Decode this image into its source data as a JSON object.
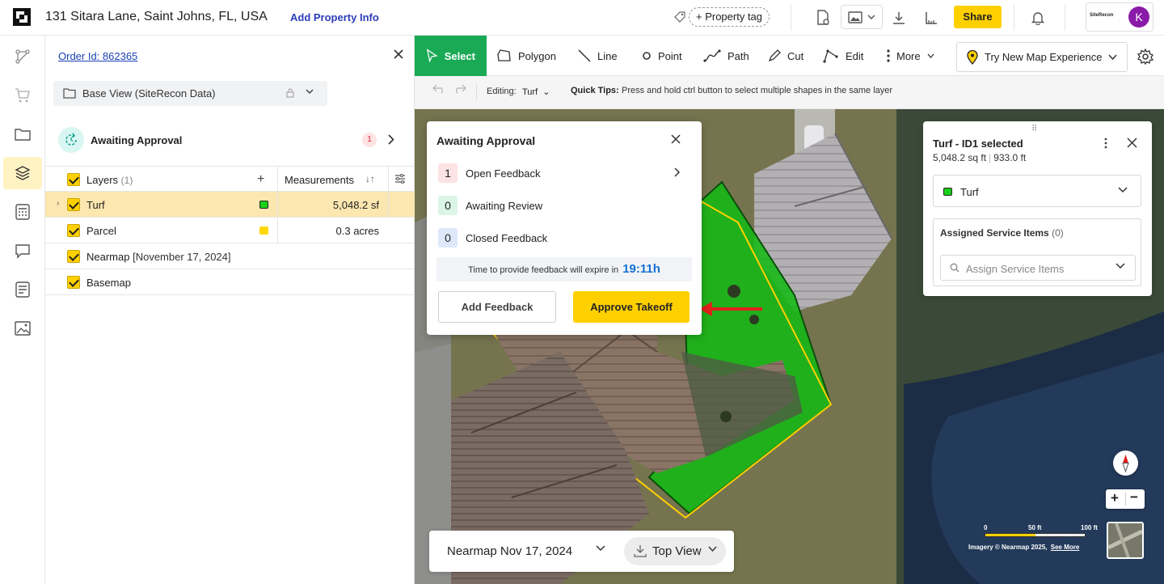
{
  "header": {
    "address": "131 Sitara Lane, Saint Johns, FL, USA",
    "add_property_info": "Add Property Info",
    "property_tag": "+ Property tag",
    "share_label": "Share",
    "account_brand": "SiteRecon",
    "avatar_initial": "K"
  },
  "panel": {
    "order_id": "Order Id: 862365",
    "base_view": "Base View (SiteRecon Data)",
    "approval": {
      "label": "Awaiting Approval",
      "count": "1"
    },
    "layers_header": {
      "label": "Layers",
      "count": "(1)",
      "measurements": "Measurements"
    },
    "layers": [
      {
        "name": "Turf",
        "extra": "",
        "measurement": "5,048.2 sf",
        "color": "#18d018"
      },
      {
        "name": "Parcel",
        "extra": "",
        "measurement": "0.3 acres",
        "color": "#ffd900"
      },
      {
        "name": "Nearmap",
        "extra": "[November 17, 2024]",
        "measurement": "",
        "color": ""
      },
      {
        "name": "Basemap",
        "extra": "",
        "measurement": "",
        "color": ""
      }
    ]
  },
  "toolbar": {
    "tools": [
      "Select",
      "Polygon",
      "Line",
      "Point",
      "Path",
      "Cut",
      "Edit",
      "More"
    ],
    "try_new": "Try New Map Experience"
  },
  "subbar": {
    "editing_label": "Editing:",
    "editing_layer": "Turf",
    "quick_tips_label": "Quick Tips:",
    "quick_tips_text": "Press and hold ctrl button to select multiple shapes in the same layer"
  },
  "popup": {
    "title": "Awaiting Approval",
    "rows": [
      {
        "count": "1",
        "label": "Open Feedback",
        "bg": "#fde3e3"
      },
      {
        "count": "0",
        "label": "Awaiting Review",
        "bg": "#dcf6e6"
      },
      {
        "count": "0",
        "label": "Closed Feedback",
        "bg": "#dde8fb"
      }
    ],
    "expire_text": "Time to provide feedback will expire in",
    "expire_time": "19:11h",
    "add_feedback": "Add Feedback",
    "approve": "Approve Takeoff"
  },
  "card": {
    "title": "Turf - ID1 selected",
    "area": "5,048.2 sq ft",
    "perimeter": "933.0 ft",
    "layer": "Turf",
    "assigned_title": "Assigned Service Items",
    "assigned_count": "(0)",
    "assign_placeholder": "Assign Service Items"
  },
  "datebar": {
    "date": "Nearmap Nov 17, 2024",
    "view": "Top View"
  },
  "scale": {
    "tick0": "0",
    "tick1": "50 ft",
    "tick2": "100 ft",
    "credit": "Imagery © Nearmap 2025,",
    "see_more": "See More"
  },
  "colors": {
    "accent": "#ffd000",
    "select_active": "#1aaa55",
    "link": "#1a3fb7"
  }
}
